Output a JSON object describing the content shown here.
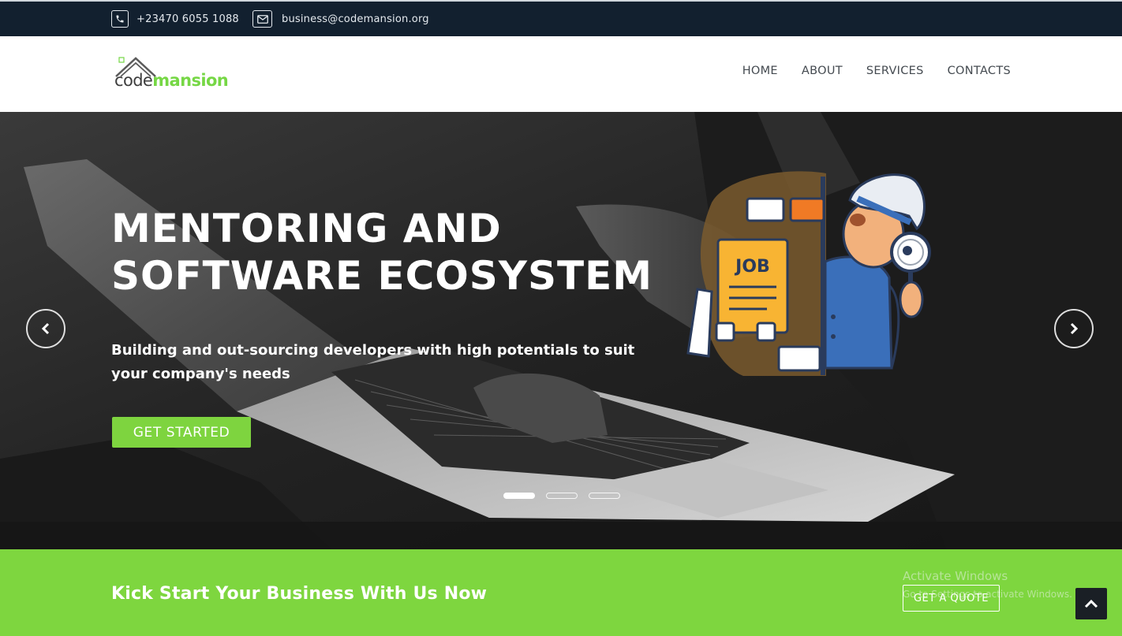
{
  "topbar": {
    "phone": "+23470 6055 1088",
    "email": "business@codemansion.org",
    "phone_icon": "phone-icon",
    "email_icon": "envelope-icon"
  },
  "brand": {
    "logo_part1": "code",
    "logo_part2": "mansion",
    "accent_color": "#7ed63f"
  },
  "nav": {
    "items": [
      {
        "label": "HOME"
      },
      {
        "label": "ABOUT"
      },
      {
        "label": "SERVICES"
      },
      {
        "label": "CONTACTS"
      }
    ]
  },
  "hero": {
    "title_line1": "MENTORING AND",
    "title_line2": "SOFTWARE ECOSYSTEM",
    "subtitle": "Building and out-sourcing developers with high potentials to suit your company's needs",
    "cta_label": "GET STARTED",
    "illustration_sign": "JOB",
    "prev_icon": "chevron-left-icon",
    "next_icon": "chevron-right-icon",
    "slide_count": 3,
    "active_slide": 1
  },
  "cta_band": {
    "text": "Kick Start Your Business With Us Now",
    "button_label": "GET A QUOTE",
    "back_to_top_icon": "chevron-up-icon"
  },
  "watermark": {
    "title": "Activate Windows",
    "subtitle": "Go to Settings to activate Windows."
  }
}
